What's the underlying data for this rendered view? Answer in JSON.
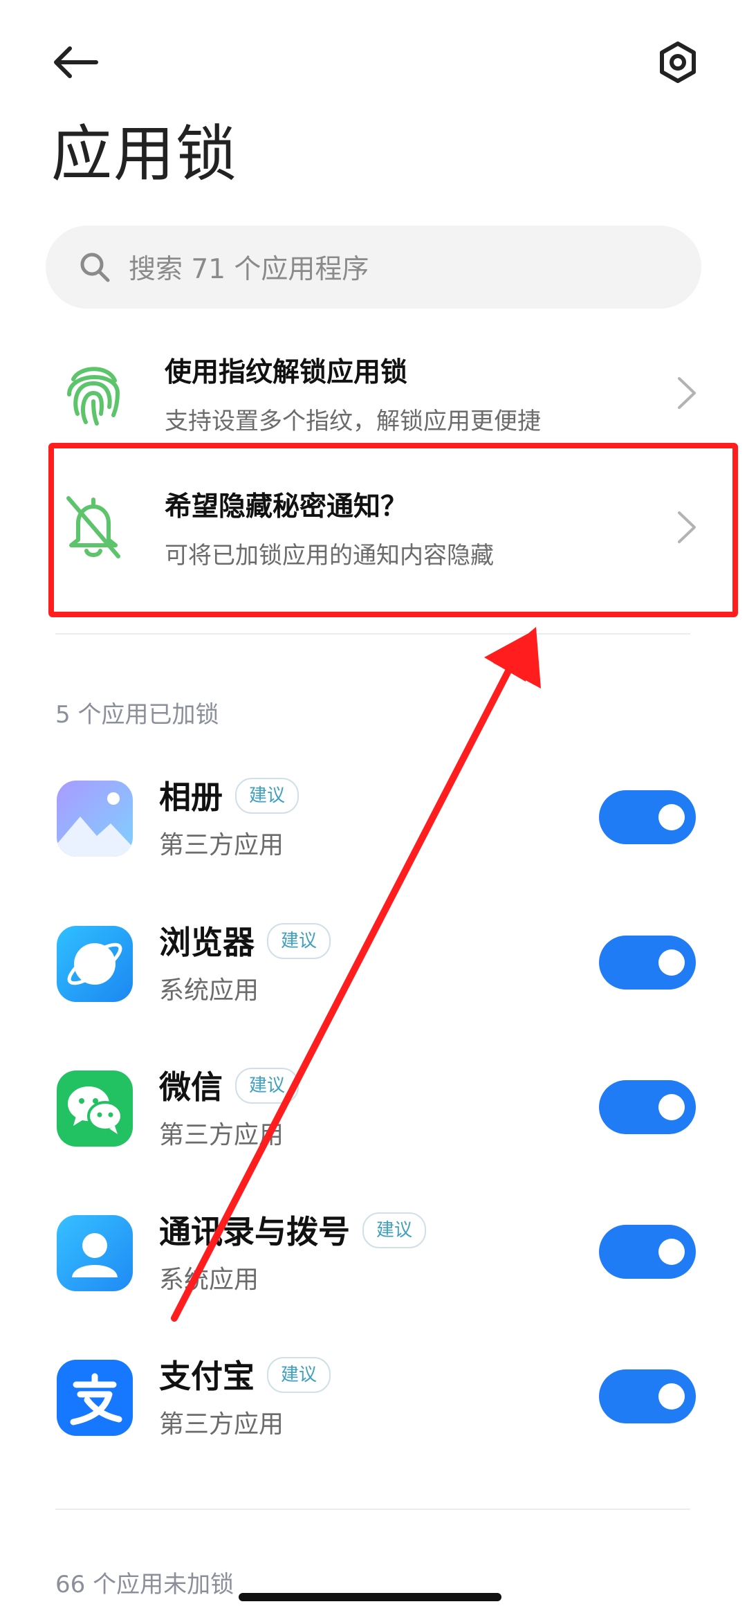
{
  "header": {
    "title": "应用锁",
    "back_icon": "arrow-left-icon",
    "settings_icon": "gear-icon"
  },
  "search": {
    "placeholder": "搜索 71 个应用程序"
  },
  "features": [
    {
      "title": "使用指纹解锁应用锁",
      "subtitle": "支持设置多个指纹，解锁应用更便捷",
      "icon": "fingerprint-icon"
    },
    {
      "title": "希望隐藏秘密通知？",
      "subtitle": "可将已加锁应用的通知内容隐藏",
      "icon": "bell-off-icon"
    }
  ],
  "locked_section": {
    "label": "5 个应用已加锁",
    "apps": [
      {
        "name": "相册",
        "tag": "建议",
        "type": "第三方应用",
        "icon": "gallery-icon",
        "enabled": true
      },
      {
        "name": "浏览器",
        "tag": "建议",
        "type": "系统应用",
        "icon": "browser-icon",
        "enabled": true
      },
      {
        "name": "微信",
        "tag": "建议",
        "type": "第三方应用",
        "icon": "wechat-icon",
        "enabled": true
      },
      {
        "name": "通讯录与拨号",
        "tag": "建议",
        "type": "系统应用",
        "icon": "contacts-icon",
        "enabled": true
      },
      {
        "name": "支付宝",
        "tag": "建议",
        "type": "第三方应用",
        "icon": "alipay-icon",
        "enabled": true
      }
    ]
  },
  "unlocked_section": {
    "label": "66 个应用未加锁"
  },
  "colors": {
    "accent": "#1f7cf5",
    "feature_green": "#5cc46a",
    "annotation_red": "#ff1d1d"
  }
}
